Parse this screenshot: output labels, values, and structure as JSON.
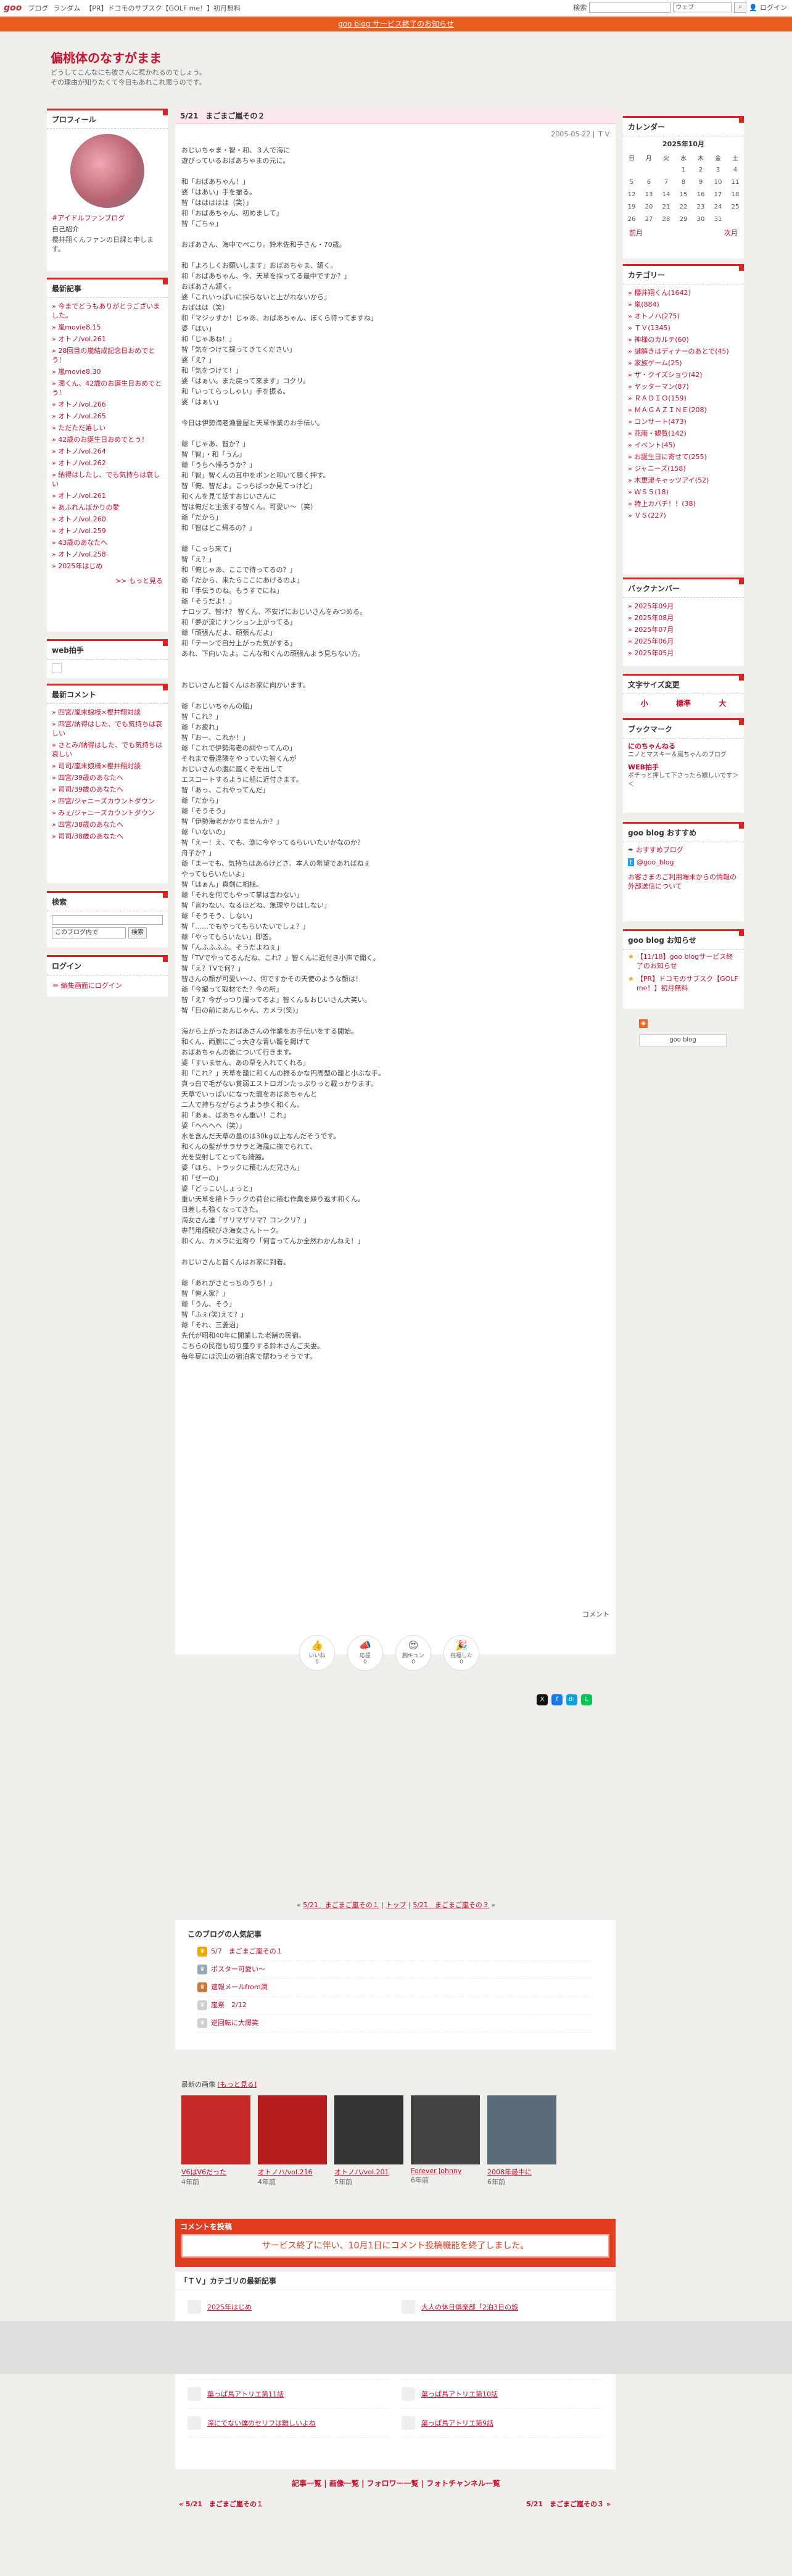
{
  "topbar": {
    "logo": "goo",
    "nav": [
      "ブログ",
      "ランダム",
      "【PR】ドコモのサブスク【GOLF me！】初月無料"
    ],
    "search_label": "検索",
    "search_scope": "ウェブ",
    "login": "ログイン"
  },
  "notice": "goo blog サービス終了のお知らせ",
  "blog": {
    "title": "偏桃体のなすがまま",
    "desc_line1": "どうしてこんなにも彼さんに惹かれるのでしょう。",
    "desc_line2": "その理由が知りたくて今日もあれこれ思うのです。"
  },
  "profile": {
    "heading": "プロフィール",
    "name": "#アイドルファンブログ",
    "intro_heading": "自己紹介",
    "intro": "櫻井翔くんファンの日課と申します。"
  },
  "recent_posts": {
    "heading": "最新記事",
    "items": [
      "今までどうもありがとうございました。",
      "嵐movie8.15",
      "オトノ/vol.261",
      "28回目の嵐結成記念日おめでとう！",
      "嵐movie8.30",
      "潤くん、42歳のお誕生日おめでとう！",
      "オトノ/vol.266",
      "オトノ/vol.265",
      "ただただ嬉しい",
      "42歳のお誕生日おめでとう！",
      "オトノ/vol.264",
      "オトノ/vol.262",
      "納得はしたし、でも気持ちは哀しい",
      "オトノ/vol.261",
      "あふれんばかりの愛",
      "オトノ/vol.260",
      "オトノ/vol.259",
      "43歳のあなたへ",
      "オトノ/vol.258",
      "2025年はじめ"
    ],
    "more": ">> もっと見る"
  },
  "webpanel": {
    "heading": "web拍手"
  },
  "recent_comments": {
    "heading": "最新コメント",
    "items": [
      "四宮/嵐末娘様×櫻井翔対談",
      "四宮/納得はした、でも気持ちは哀しい",
      "さとみ/納得はした、でも気持ちは哀しい",
      "司司/嵐末娘様×櫻井翔対談",
      "四宮/39歳のあなたへ",
      "司司/39歳のあなたへ",
      "四宮/ジャニーズカウントダウン",
      "みぇ/ジャニーズカウントダウン",
      "四宮/38歳のあなたへ",
      "司司/38歳のあなたへ"
    ]
  },
  "search": {
    "heading": "検索",
    "scope": "このブログ内で",
    "button": "検索"
  },
  "login": {
    "heading": "ログイン",
    "link": "編集画面にログイン"
  },
  "calendar": {
    "heading": "カレンダー",
    "month": "2025年10月",
    "weekdays": [
      "日",
      "月",
      "火",
      "水",
      "木",
      "金",
      "土"
    ],
    "rows": [
      [
        "",
        "",
        "",
        "1",
        "2",
        "3",
        "4"
      ],
      [
        "5",
        "6",
        "7",
        "8",
        "9",
        "10",
        "11"
      ],
      [
        "12",
        "13",
        "14",
        "15",
        "16",
        "17",
        "18"
      ],
      [
        "19",
        "20",
        "21",
        "22",
        "23",
        "24",
        "25"
      ],
      [
        "26",
        "27",
        "28",
        "29",
        "30",
        "31",
        ""
      ]
    ],
    "prev": "前月",
    "next": "次月"
  },
  "categories": {
    "heading": "カテゴリー",
    "items": [
      "櫻井翔くん(1642)",
      "嵐(884)",
      "オトノハ(275)",
      "ＴＶ(1345)",
      "神様のカルテ(60)",
      "謎解きはディナーのあとで(45)",
      "家族ゲーム(25)",
      "ザ・クイズショウ(42)",
      "ヤッターマン(87)",
      "ＲＡＤＩＯ(159)",
      "ＭＡＧＡＺＩＮＥ(208)",
      "コンサート(473)",
      "花雨・観覧(142)",
      "イベント(45)",
      "お誕生日に寄せて(255)",
      "ジャニーズ(158)",
      "木更津キャッツアイ(52)",
      "ＷＳ５(18)",
      "特上カバチ！！(38)",
      "ＶＳ(227)"
    ]
  },
  "backnumber": {
    "heading": "バックナンバー",
    "items": [
      "2025年09月",
      "2025年08月",
      "2025年07月",
      "2025年06月",
      "2025年05月"
    ]
  },
  "fontsize": {
    "heading": "文字サイズ変更",
    "options": [
      "小",
      "標準",
      "大"
    ]
  },
  "bookmark": {
    "heading": "ブックマーク",
    "items": [
      {
        "title": "にのちゃんねる",
        "desc": "ニノとマスキー＆嵐ちゃんのブログ"
      },
      {
        "title": "WEB拍手",
        "desc": "ポチっと押して下さったら嬉しいです＞＜"
      }
    ]
  },
  "goo_recommend": {
    "heading": "goo blog おすすめ",
    "items": [
      "おすすめブログ",
      "@goo_blog"
    ],
    "note": "お客さまのご利用端末からの情報の外部送信について"
  },
  "goo_notice": {
    "heading": "goo blog お知らせ",
    "items": [
      "【11/18】goo blogサービス終了のお知らせ",
      "【PR】ドコモのサブスク【GOLF me！】初月無料"
    ]
  },
  "rss": "goo blog",
  "article": {
    "title": "5/21　まごまご嵐その２",
    "meta": "2005-05-22 | ＴＶ",
    "body": [
      "おじいちゃま・智・和、３人で海に",
      "遊びっているおばあちゃまの元に。",
      "",
      "和「おばあちゃん！」",
      "婆「はあい」手を振る。",
      "智「ははははは（笑）」",
      "和「おばあちゃん、初めまして」",
      "智「ごちゃ」",
      "",
      "おばあさん、海中でペこり。鈴木佐和子さん・70歳。",
      "",
      "和「よろしくお願いします」おばあちゃま、頷く。",
      "和「おばあちゃん、今、天草を採ってる最中ですか？」",
      "おばあさん頷く。",
      "婆「これいっぱいに採らないと上がれないから」",
      "おばはは（笑）",
      "和「マジッすか！じゃあ、おばあちゃん、ぼくら待ってますね」",
      "婆「はい」",
      "和「じゃあね！」",
      "智「気をつけて採ってきてください」",
      "婆「え？」",
      "和「気をつけて！」",
      "婆「はぁい。また戻って来ます」コクリ。",
      "和「いってらっしゃい」手を振る。",
      "婆「はぁい」",
      "",
      "今日は伊勢海老漁番屋と天草作業のお手伝い。",
      "",
      "爺「じゃあ、智か？」",
      "智「智」・和「うん」",
      "爺「うちへ帰ろうか？」",
      "和「智」智くんの耳中をポンと叩いて膝く押す。",
      "智「俺、智だよ。こっちばっか見てっけど」",
      "和くんを見て話すおじいさんに",
      "智は俺だと主張する智くん。可愛い～（笑）",
      "爺「だから」",
      "和「智はどこ帰るの？」",
      "",
      "爺「こっち来て」",
      "智「え？」",
      "和「俺じゃあ、ここで待ってるの？」",
      "爺「だから、来たらここにあげるのよ」",
      "和「手伝うのね。もうすでにね」",
      "爺「そうだよ！」",
      "ナロップ、智け？ 智くん、不安げにおじいさんをみつめる。",
      "和「夢が流にナンション上がってる」",
      "爺「頑張んだよ、頑張んだよ」",
      "和「テーンで自分上がった気がする」",
      "あれ、下向いたよ。こんな和くんの頑張んよう見ちない方。",
      "",
      "",
      "おじいさんと智くんはお家に向かいます。",
      "",
      "爺「おじいちゃんの船」",
      "智「これ？」",
      "爺「お疲れ」",
      "智「おー、これか！」",
      "爺「これで伊勢海老の網やってんの」",
      "それまで番違隣をやっていた智くんが",
      "おじいさんの腹に嵐くぞを出して",
      "エスコートするように船に近付きます。",
      "智「あっ、これやってんだ」",
      "爺「だから」",
      "爺「そうそう」",
      "智「伊勢海老かかりませんか？」",
      "爺「いないの」",
      "智「えー！え、でも、漁に今やってるらいいたいかなのか？",
      "舟子か？」",
      "爺「まーでも、気持ちはあるけどさ、本人の希望であればねぇ",
      "やってもらいたいよ」",
      "智「はぁん」真剣に相槌。",
      "爺「それを何でもやって掌は言わない」",
      "智「言わない、なるほどね、無理やりはしない」",
      "爺「そうそう、しない」",
      "智「……でもやってもらいたいでしょ？」",
      "爺「やってもらいたい」即答。",
      "智「んふふふふ。そうだよねぇ」",
      "智「TVでやってるんだね、これ？」智くんに近付き小声で聞く。",
      "智「え？TVで何？」",
      "智さんの顔が可愛い～♪、何ですかその天使のような顔は！",
      "爺「今撮って取材でた？今の所」",
      "智「え？今がっつり撮ってるよ」智くん＆おじいさん大笑い。",
      "智「目の前にあんじゃん、カメラ(笑)」",
      "",
      "海から上がったおばあさんの作業をお手伝いをする開始。",
      "和くん、両腕にごっ大きな青い籠を掲げて",
      "おばあちゃんの後について行きます。",
      "婆「すいません、あの草を入れてくれる」",
      "和「これ？」天草を籠に和くんの振るかな円周型の籠と小ぶな手。",
      "真っ白で毛がない貧弱エストロガンたっぷりっと載っかります。",
      "天草でいっぱいになった籠をおばあちゃんと",
      "二人で持ちながらようよう歩く和くん。",
      "和「あぁ、ばあちゃん重い！これ」",
      "婆「ヘヘヘヘ（笑）」",
      "水を含んだ天草の量のは30kg以上なんだそうです。",
      "和くんの髪がサラサラと海風に撫でられて、",
      "光を受射してとっても綺麗。",
      "婆「ほら、トラックに積むんだ兄さん」",
      "和「ぜーの」",
      "婆「どっこいしょっと」",
      "重い天草を積トラックの荷台に積む作業を繰り返す和くん。",
      "日差しも強くなってきた。",
      "海女さん達「ザリマザリマ？コンクリ？」",
      "専門用語続びき海女さんトーク。",
      "和くん、カメラに近寄り「何言ってんか全然わかんねえ！」",
      "",
      "おじいさんと智くんはお家に到着。",
      "",
      "爺「あれがさとっちのうち！」",
      "智「俺人家？」",
      "爺「うん、そう」",
      "智「ふぇ(笑)えて？」",
      "爺「それ、三菱沼」",
      "先代が昭和40年に開業した老舗の民宿。",
      "こちらの民宿も切り盛りする鈴木さんご夫妻。",
      "毎年夏には沢山の宿泊客で賑わうそうです。"
    ],
    "comment_link": "コメント",
    "reactions": [
      {
        "icon": "👍",
        "label": "いいね",
        "count": "0"
      },
      {
        "icon": "📣",
        "label": "応援",
        "count": "0"
      },
      {
        "icon": "😍",
        "label": "胸キュン",
        "count": "0"
      },
      {
        "icon": "🎉",
        "label": "祝福した",
        "count": "0"
      }
    ]
  },
  "pager": {
    "prev": "5/21　まごまご嵐その１",
    "top": "トップ",
    "next": "5/21　まごまご嵐その３"
  },
  "recommend": {
    "heading": "このブログの人気記事",
    "items": [
      "5/7　まごまご嵐その１",
      "ポスター可愛い～",
      "速報メールfrom潤",
      "嵐祭　2/12",
      "逆回転に大爆笑"
    ]
  },
  "recent_images": {
    "heading": "最新の画像",
    "more": "[もっと見る]",
    "items": [
      {
        "caption": "V6はV6だった",
        "ago": "4年前"
      },
      {
        "caption": "オトノハ/vol.216",
        "ago": "4年前"
      },
      {
        "caption": "オトノハ/vol.201",
        "ago": "5年前"
      },
      {
        "caption": "Forever Johnny",
        "ago": "6年前"
      },
      {
        "caption": "2008年最中に",
        "ago": "6年前"
      }
    ]
  },
  "comment_section": {
    "heading": "コメントを投稿",
    "message": "サービス終了に伴い、10月1日にコメント投稿機能を終了しました。"
  },
  "category_articles": {
    "heading": "「ＴＶ」カテゴリの最新記事",
    "items": [
      "2025年はじめ",
      "大人の休日倶楽部「2泊3日の旅",
      "",
      "",
      "",
      "",
      "葉っぱ鳥アトリエ第11話",
      "葉っぱ鳥アトリエ第10話",
      "深にでない僕のセリフは難しいよね",
      "葉っぱ鳥アトリエ第9話"
    ]
  },
  "footer": {
    "links": "記事一覧 | 画像一覧 | フォロワー一覧 | フォトチャンネル一覧",
    "prev": "« 5/21　まごまご嵐その１",
    "next": "5/21　まごまご嵐その３ »"
  }
}
